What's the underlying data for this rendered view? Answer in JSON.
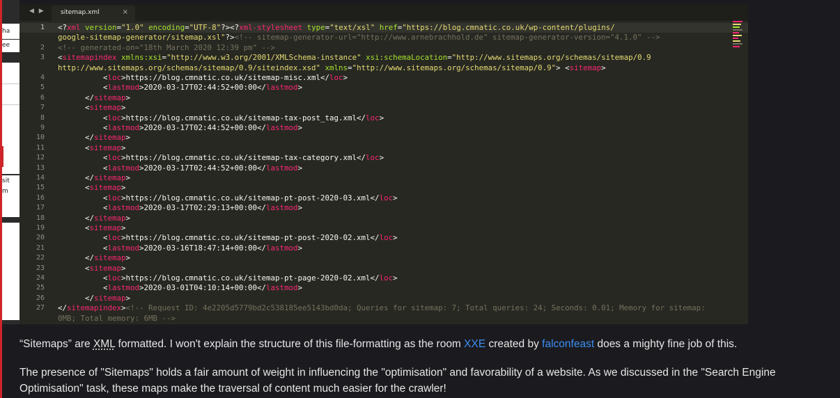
{
  "editor": {
    "tab_title": "sitemap.xml",
    "close_glyph": "×",
    "nav_glyph": "◀ ▶",
    "active_line": 1,
    "lines": [
      {
        "n": "1",
        "parts": [
          [
            "p",
            "<?"
          ],
          [
            "t",
            "xml"
          ],
          [
            "a",
            " version"
          ],
          [
            "p",
            "="
          ],
          [
            "s",
            "\"1.0\""
          ],
          [
            "a",
            " encoding"
          ],
          [
            "p",
            "="
          ],
          [
            "s",
            "\"UTF-8\""
          ],
          [
            "p",
            "?><?"
          ],
          [
            "t",
            "xml-stylesheet"
          ],
          [
            "a",
            " type"
          ],
          [
            "p",
            "="
          ],
          [
            "s",
            "\"text/xsl\""
          ],
          [
            "a",
            " href"
          ],
          [
            "p",
            "="
          ],
          [
            "s",
            "\"https://blog.cmnatic.co.uk/wp-content/plugins/"
          ]
        ]
      },
      {
        "n": "",
        "parts": [
          [
            "s",
            "google-sitemap-generator/sitemap.xsl\""
          ],
          [
            "p",
            "?>"
          ],
          [
            "c",
            "<!-- sitemap-generator-url=\"http://www.arnebrachhold.de\" sitemap-generator-version=\"4.1.0\" -->"
          ]
        ]
      },
      {
        "n": "2",
        "parts": [
          [
            "c",
            "<!-- generated-on=\"18th March 2020 12:39 pm\" -->"
          ]
        ]
      },
      {
        "n": "3",
        "parts": [
          [
            "p",
            "<"
          ],
          [
            "t",
            "sitemapindex"
          ],
          [
            "a",
            " xmlns:xsi"
          ],
          [
            "p",
            "="
          ],
          [
            "s",
            "\"http://www.w3.org/2001/XMLSchema-instance\""
          ],
          [
            "a",
            " xsi:schemaLocation"
          ],
          [
            "p",
            "="
          ],
          [
            "s",
            "\"http://www.sitemaps.org/schemas/sitemap/0.9"
          ]
        ]
      },
      {
        "n": "",
        "parts": [
          [
            "s",
            "http://www.sitemaps.org/schemas/sitemap/0.9/siteindex.xsd\""
          ],
          [
            "a",
            " xmlns"
          ],
          [
            "p",
            "="
          ],
          [
            "s",
            "\"http://www.sitemaps.org/schemas/sitemap/0.9\""
          ],
          [
            "p",
            "> <"
          ],
          [
            "t",
            "sitemap"
          ],
          [
            "p",
            ">"
          ]
        ]
      },
      {
        "n": "4",
        "parts": [
          [
            "p",
            "          <"
          ],
          [
            "t",
            "loc"
          ],
          [
            "p",
            ">https://blog.cmnatic.co.uk/sitemap-misc.xml</"
          ],
          [
            "t",
            "loc"
          ],
          [
            "p",
            ">"
          ]
        ]
      },
      {
        "n": "5",
        "parts": [
          [
            "p",
            "          <"
          ],
          [
            "t",
            "lastmod"
          ],
          [
            "p",
            ">2020-03-17T02:44:52+00:00</"
          ],
          [
            "t",
            "lastmod"
          ],
          [
            "p",
            ">"
          ]
        ]
      },
      {
        "n": "6",
        "parts": [
          [
            "p",
            "      </"
          ],
          [
            "t",
            "sitemap"
          ],
          [
            "p",
            ">"
          ]
        ]
      },
      {
        "n": "7",
        "parts": [
          [
            "p",
            "      <"
          ],
          [
            "t",
            "sitemap"
          ],
          [
            "p",
            ">"
          ]
        ]
      },
      {
        "n": "8",
        "parts": [
          [
            "p",
            "          <"
          ],
          [
            "t",
            "loc"
          ],
          [
            "p",
            ">https://blog.cmnatic.co.uk/sitemap-tax-post_tag.xml</"
          ],
          [
            "t",
            "loc"
          ],
          [
            "p",
            ">"
          ]
        ]
      },
      {
        "n": "9",
        "parts": [
          [
            "p",
            "          <"
          ],
          [
            "t",
            "lastmod"
          ],
          [
            "p",
            ">2020-03-17T02:44:52+00:00</"
          ],
          [
            "t",
            "lastmod"
          ],
          [
            "p",
            ">"
          ]
        ]
      },
      {
        "n": "10",
        "parts": [
          [
            "p",
            "      </"
          ],
          [
            "t",
            "sitemap"
          ],
          [
            "p",
            ">"
          ]
        ]
      },
      {
        "n": "11",
        "parts": [
          [
            "p",
            "      <"
          ],
          [
            "t",
            "sitemap"
          ],
          [
            "p",
            ">"
          ]
        ]
      },
      {
        "n": "12",
        "parts": [
          [
            "p",
            "          <"
          ],
          [
            "t",
            "loc"
          ],
          [
            "p",
            ">https://blog.cmnatic.co.uk/sitemap-tax-category.xml</"
          ],
          [
            "t",
            "loc"
          ],
          [
            "p",
            ">"
          ]
        ]
      },
      {
        "n": "13",
        "parts": [
          [
            "p",
            "          <"
          ],
          [
            "t",
            "lastmod"
          ],
          [
            "p",
            ">2020-03-17T02:44:52+00:00</"
          ],
          [
            "t",
            "lastmod"
          ],
          [
            "p",
            ">"
          ]
        ]
      },
      {
        "n": "14",
        "parts": [
          [
            "p",
            "      </"
          ],
          [
            "t",
            "sitemap"
          ],
          [
            "p",
            ">"
          ]
        ]
      },
      {
        "n": "15",
        "parts": [
          [
            "p",
            "      <"
          ],
          [
            "t",
            "sitemap"
          ],
          [
            "p",
            ">"
          ]
        ]
      },
      {
        "n": "16",
        "parts": [
          [
            "p",
            "          <"
          ],
          [
            "t",
            "loc"
          ],
          [
            "p",
            ">https://blog.cmnatic.co.uk/sitemap-pt-post-2020-03.xml</"
          ],
          [
            "t",
            "loc"
          ],
          [
            "p",
            ">"
          ]
        ]
      },
      {
        "n": "17",
        "parts": [
          [
            "p",
            "          <"
          ],
          [
            "t",
            "lastmod"
          ],
          [
            "p",
            ">2020-03-17T02:29:13+00:00</"
          ],
          [
            "t",
            "lastmod"
          ],
          [
            "p",
            ">"
          ]
        ]
      },
      {
        "n": "18",
        "parts": [
          [
            "p",
            "      </"
          ],
          [
            "t",
            "sitemap"
          ],
          [
            "p",
            ">"
          ]
        ]
      },
      {
        "n": "19",
        "parts": [
          [
            "p",
            "      <"
          ],
          [
            "t",
            "sitemap"
          ],
          [
            "p",
            ">"
          ]
        ]
      },
      {
        "n": "20",
        "parts": [
          [
            "p",
            "          <"
          ],
          [
            "t",
            "loc"
          ],
          [
            "p",
            ">https://blog.cmnatic.co.uk/sitemap-pt-post-2020-02.xml</"
          ],
          [
            "t",
            "loc"
          ],
          [
            "p",
            ">"
          ]
        ]
      },
      {
        "n": "21",
        "parts": [
          [
            "p",
            "          <"
          ],
          [
            "t",
            "lastmod"
          ],
          [
            "p",
            ">2020-03-16T18:47:14+00:00</"
          ],
          [
            "t",
            "lastmod"
          ],
          [
            "p",
            ">"
          ]
        ]
      },
      {
        "n": "22",
        "parts": [
          [
            "p",
            "      </"
          ],
          [
            "t",
            "sitemap"
          ],
          [
            "p",
            ">"
          ]
        ]
      },
      {
        "n": "23",
        "parts": [
          [
            "p",
            "      <"
          ],
          [
            "t",
            "sitemap"
          ],
          [
            "p",
            ">"
          ]
        ]
      },
      {
        "n": "24",
        "parts": [
          [
            "p",
            "          <"
          ],
          [
            "t",
            "loc"
          ],
          [
            "p",
            ">https://blog.cmnatic.co.uk/sitemap-pt-page-2020-02.xml</"
          ],
          [
            "t",
            "loc"
          ],
          [
            "p",
            ">"
          ]
        ]
      },
      {
        "n": "25",
        "parts": [
          [
            "p",
            "          <"
          ],
          [
            "t",
            "lastmod"
          ],
          [
            "p",
            ">2020-03-01T04:10:14+00:00</"
          ],
          [
            "t",
            "lastmod"
          ],
          [
            "p",
            ">"
          ]
        ]
      },
      {
        "n": "26",
        "parts": [
          [
            "p",
            "      </"
          ],
          [
            "t",
            "sitemap"
          ],
          [
            "p",
            ">"
          ]
        ]
      },
      {
        "n": "27",
        "parts": [
          [
            "p",
            "</"
          ],
          [
            "t",
            "sitemapindex"
          ],
          [
            "p",
            ">"
          ],
          [
            "c",
            "<!-- Request ID: 4e2205d5779bd2c538185ee5143bd0da; Queries for sitemap: 7; Total queries: 24; Seconds: 0.01; Memory for sitemap:"
          ]
        ]
      },
      {
        "n": "",
        "parts": [
          [
            "c",
            "0MB; Total memory: 6MB -->"
          ]
        ]
      }
    ]
  },
  "left_fragments": [
    "ha",
    "ee",
    "sit",
    "m"
  ],
  "article": {
    "p1": {
      "q1": "“Sitemaps” are ",
      "xml": "XML",
      "mid1": " formatted. I won't explain the structure of this file-formatting as the room ",
      "xxe": "XXE",
      "mid2": " created by ",
      "author": "falconfeast",
      "end": " does a mighty fine job of this."
    },
    "p2": "The presence of \"Sitemaps\" holds a fair amount of weight in influencing the \"optimisation\" and favorability of a website. As we discussed in the \"Search Engine Optimisation\" task, these maps make the traversal of content much easier for the crawler!"
  },
  "colors": {
    "accent": "#d0232a",
    "link": "#3c8df0",
    "tag": "#f92672",
    "attr": "#a6e22e",
    "string": "#e6db74",
    "comment": "#75715e",
    "editor_bg": "#272822"
  }
}
